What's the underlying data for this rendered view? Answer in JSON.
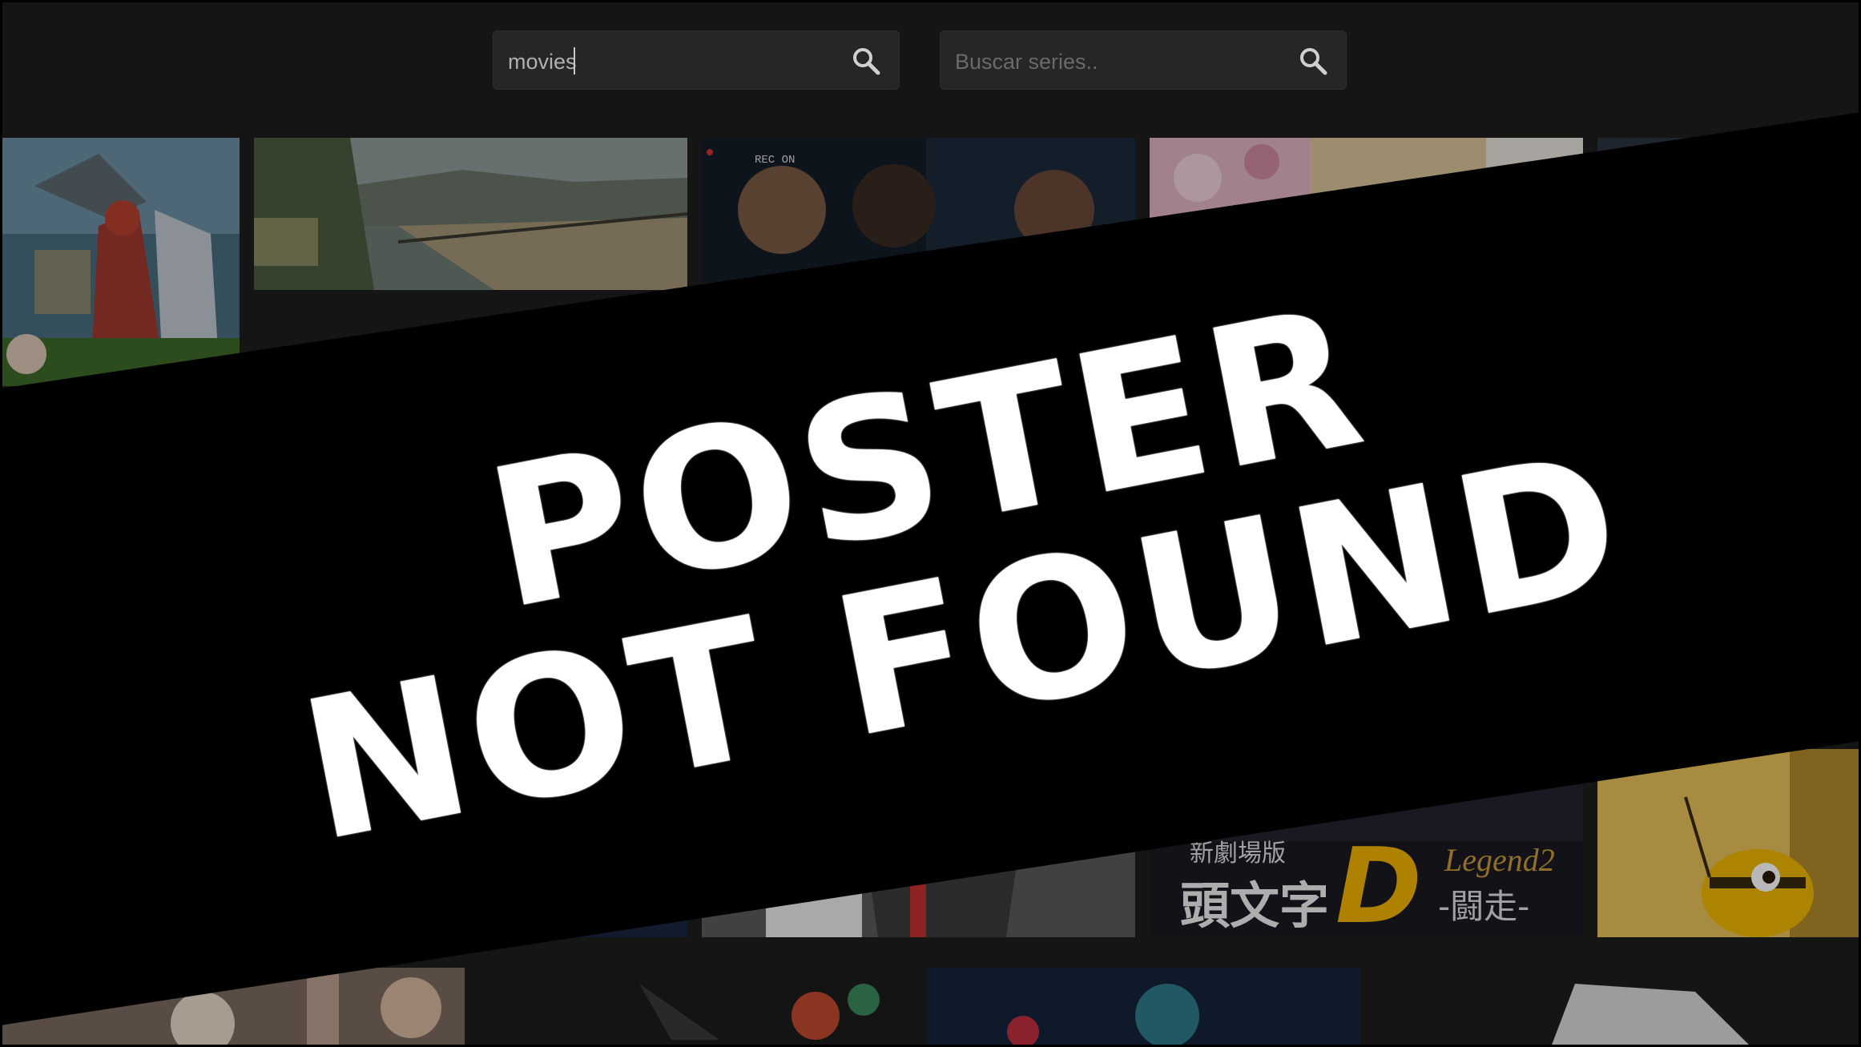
{
  "search_movies": {
    "value": "movies",
    "placeholder": ""
  },
  "search_series": {
    "value": "",
    "placeholder": "Buscar series.."
  },
  "banner": {
    "line1": "POSTER",
    "line2": "NOT FOUND"
  },
  "posters": {
    "row1": [
      "anime-fantasy-poster",
      "mountain-road-anime-poster",
      "found-footage-poster",
      "pink-floral-anime-poster",
      "partial-poster"
    ],
    "row2": [
      "dark-poster",
      "dark-poster",
      "suit-figure-poster",
      "initial-d-legend-2-poster",
      "bee-movie-poster"
    ],
    "row3": [
      "party-poster",
      "dark-action-anime-poster",
      "green-hair-anime-poster",
      "car-poster"
    ]
  },
  "poster_texts": {
    "initial_d_title": "新劇場版",
    "initial_d_kanji": "頭文字",
    "initial_d_letter": "D",
    "initial_d_legend": "Legend2",
    "initial_d_sub": "-闘走-",
    "found_footage_rec": "REC ON"
  },
  "colors": {
    "background": "#151515",
    "search_bg": "#262626",
    "banner_bg": "#000000",
    "banner_text": "#ffffff"
  }
}
